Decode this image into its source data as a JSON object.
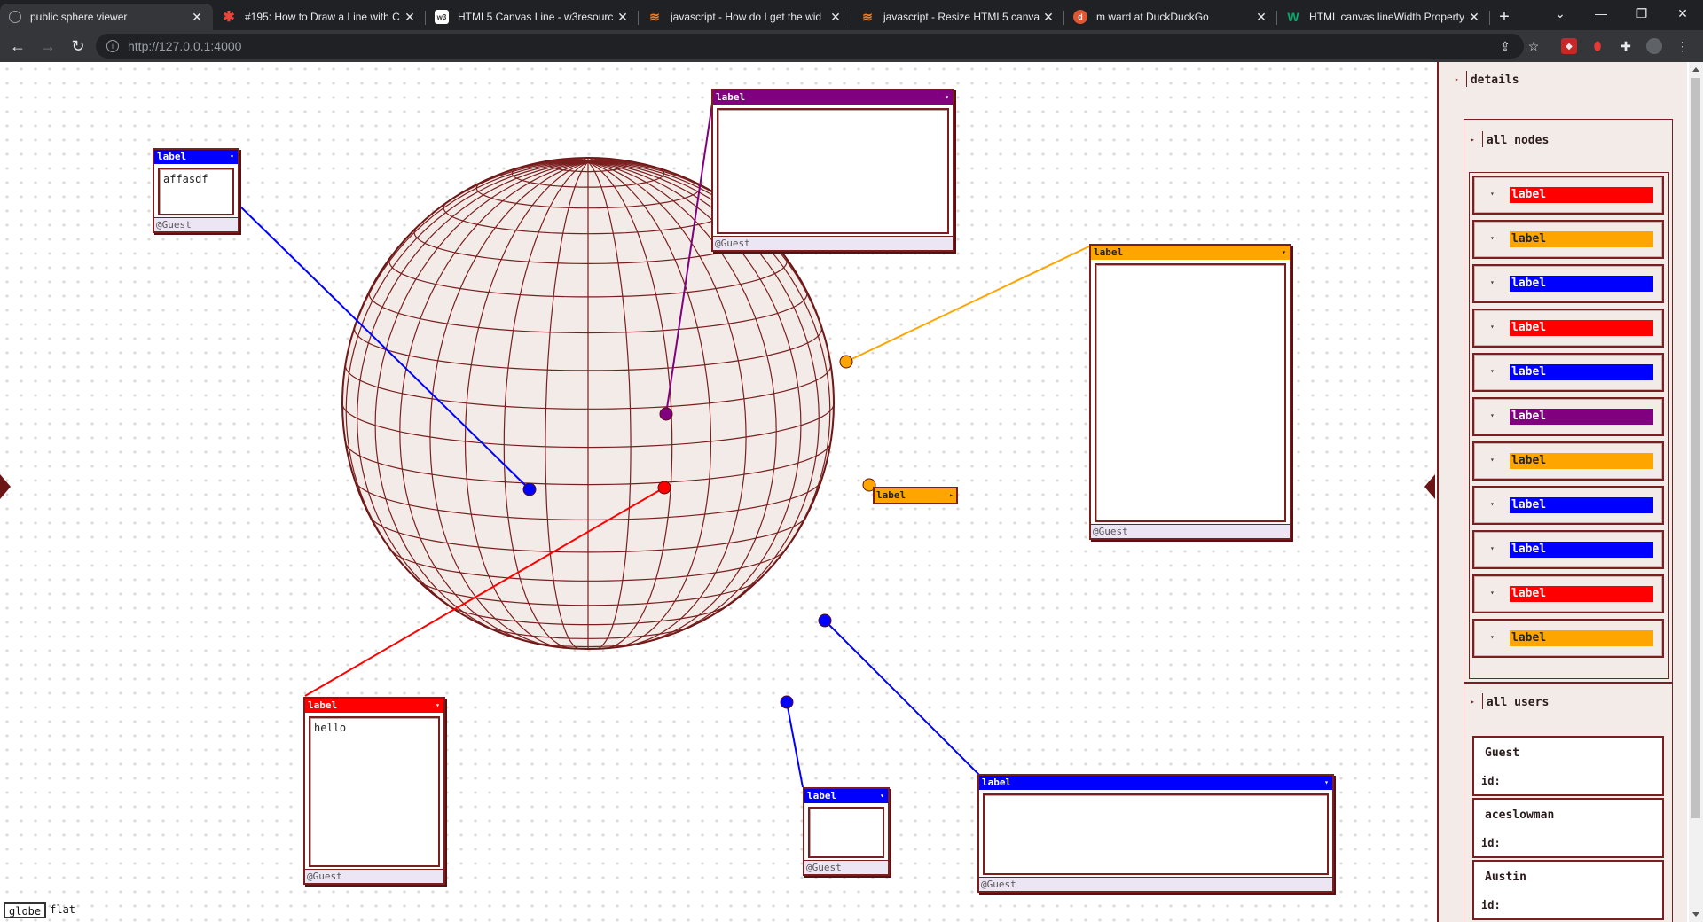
{
  "browser": {
    "tabs": [
      {
        "title": "public sphere viewer",
        "favicon": "globe-icon",
        "fav_color": "#9aa0a6"
      },
      {
        "title": "#195: How to Draw a Line with C",
        "favicon": "asterisk-icon",
        "fav_color": "#e8453c"
      },
      {
        "title": "HTML5 Canvas Line - w3resourc",
        "favicon": "w3-icon",
        "fav_color": "#ffffff"
      },
      {
        "title": "javascript - How do I get the wid",
        "favicon": "stackoverflow-icon",
        "fav_color": "#f48024"
      },
      {
        "title": "javascript - Resize HTML5 canva",
        "favicon": "stackoverflow-icon",
        "fav_color": "#f48024"
      },
      {
        "title": "m ward at DuckDuckGo",
        "favicon": "duckduckgo-icon",
        "fav_color": "#de5833"
      },
      {
        "title": "HTML canvas lineWidth Property",
        "favicon": "w3schools-icon",
        "fav_color": "#04aa6d"
      }
    ],
    "url": "http://127.0.0.1:4000"
  },
  "notes": [
    {
      "id": "n1",
      "label": "label",
      "text": "affasdf",
      "user": "@Guest",
      "color": "#0000ff"
    },
    {
      "id": "n2",
      "label": "label",
      "text": "",
      "user": "@Guest",
      "color": "#800080"
    },
    {
      "id": "n3",
      "label": "label",
      "text": "",
      "user": "@Guest",
      "color": "#ffa500"
    },
    {
      "id": "n4",
      "label": "label",
      "text": "hello",
      "user": "@Guest",
      "color": "#ff0000"
    },
    {
      "id": "n5",
      "label": "label",
      "text": "",
      "user": "@Guest",
      "color": "#0000ff"
    },
    {
      "id": "n6",
      "label": "label",
      "text": "",
      "user": "@Guest",
      "color": "#0000ff"
    }
  ],
  "pin_label": {
    "label": "label",
    "color": "#ffa500"
  },
  "view_modes": {
    "globe": "globe",
    "flat": "flat"
  },
  "panel": {
    "details_title": "details",
    "all_nodes_title": "all nodes",
    "all_users_title": "all users",
    "nodes": [
      {
        "label": "label",
        "color": "#ff0000"
      },
      {
        "label": "label",
        "color": "#ffa500"
      },
      {
        "label": "label",
        "color": "#0000ff"
      },
      {
        "label": "label",
        "color": "#ff0000"
      },
      {
        "label": "label",
        "color": "#0000ff"
      },
      {
        "label": "label",
        "color": "#800080"
      },
      {
        "label": "label",
        "color": "#ffa500"
      },
      {
        "label": "label",
        "color": "#0000ff"
      },
      {
        "label": "label",
        "color": "#0000ff"
      },
      {
        "label": "label",
        "color": "#ff0000"
      },
      {
        "label": "label",
        "color": "#ffa500"
      }
    ],
    "users": [
      {
        "name": "Guest",
        "id_label": "id:"
      },
      {
        "name": "aceslowman",
        "id_label": "id:"
      },
      {
        "name": "Austin",
        "id_label": "id:"
      }
    ]
  }
}
